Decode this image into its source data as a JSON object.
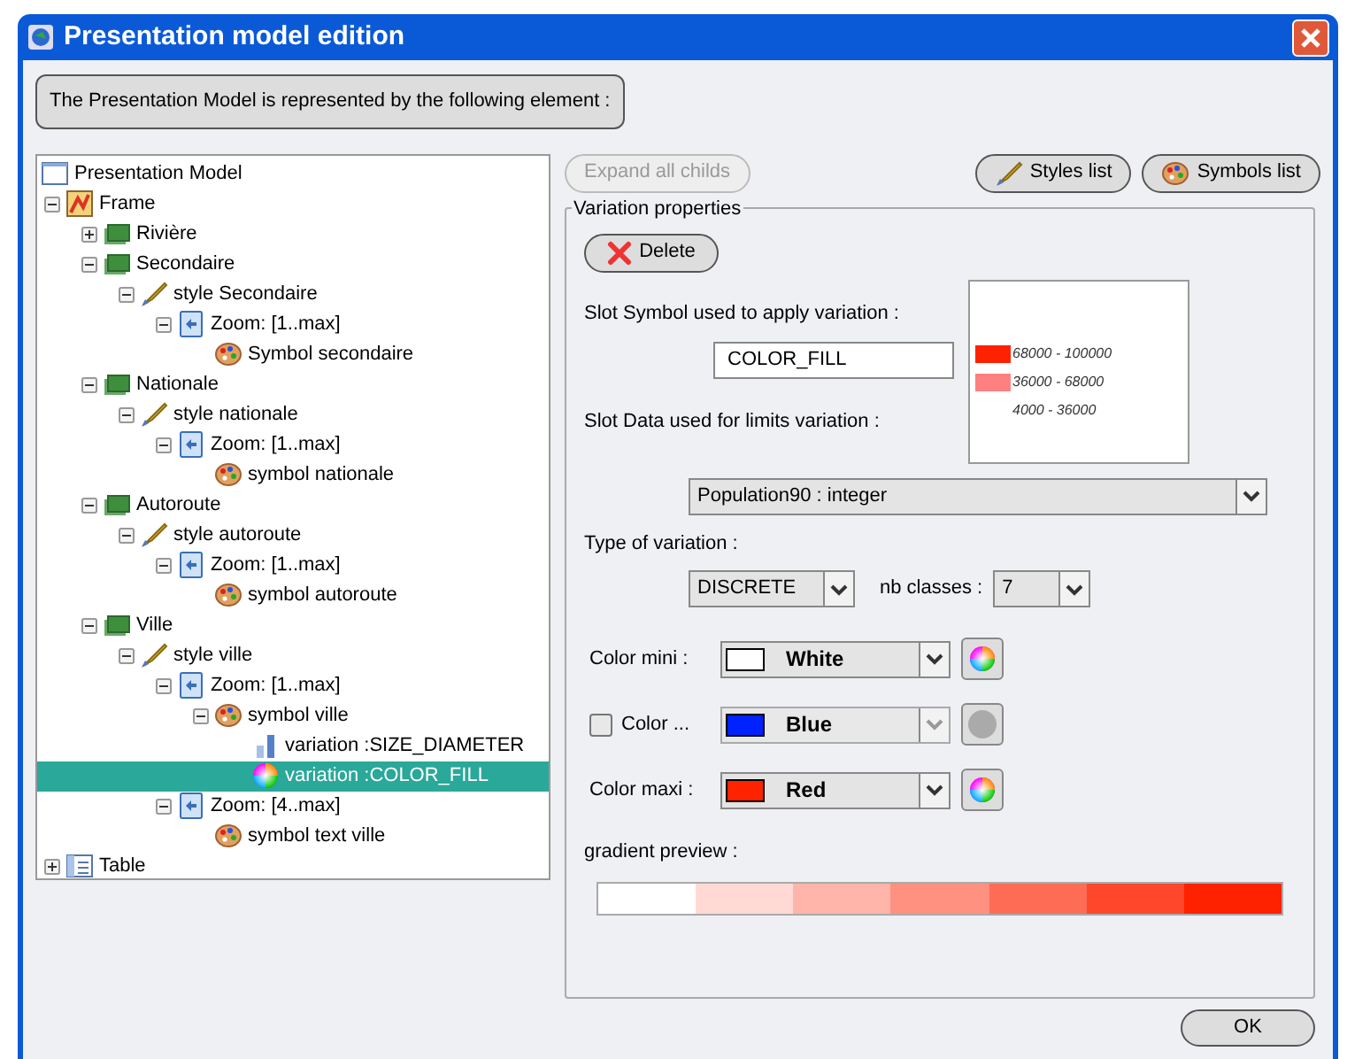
{
  "window": {
    "title": "Presentation model edition"
  },
  "header": "The Presentation Model is represented by the following element :",
  "tree": {
    "label": "Presentation Model",
    "kind": "root",
    "children": [
      {
        "label": "Frame",
        "kind": "frame",
        "expanded": true,
        "selected": false,
        "children": [
          {
            "label": "Rivière",
            "kind": "layer",
            "expanded": false,
            "selected": false
          },
          {
            "label": "Secondaire",
            "kind": "layer",
            "expanded": true,
            "selected": false,
            "children": [
              {
                "label": "style Secondaire",
                "kind": "style",
                "expanded": true,
                "selected": false,
                "children": [
                  {
                    "label": "Zoom: [1..max]",
                    "kind": "zoom",
                    "expanded": true,
                    "selected": false,
                    "children": [
                      {
                        "label": "Symbol secondaire",
                        "kind": "symbol",
                        "selected": false
                      }
                    ]
                  }
                ]
              }
            ]
          },
          {
            "label": "Nationale",
            "kind": "layer",
            "expanded": true,
            "selected": false,
            "children": [
              {
                "label": "style nationale",
                "kind": "style",
                "expanded": true,
                "selected": false,
                "children": [
                  {
                    "label": "Zoom: [1..max]",
                    "kind": "zoom",
                    "expanded": true,
                    "selected": false,
                    "children": [
                      {
                        "label": "symbol nationale",
                        "kind": "symbol",
                        "selected": false
                      }
                    ]
                  }
                ]
              }
            ]
          },
          {
            "label": "Autoroute",
            "kind": "layer",
            "expanded": true,
            "selected": false,
            "children": [
              {
                "label": "style autoroute",
                "kind": "style",
                "expanded": true,
                "selected": false,
                "children": [
                  {
                    "label": "Zoom: [1..max]",
                    "kind": "zoom",
                    "expanded": true,
                    "selected": false,
                    "children": [
                      {
                        "label": "symbol autoroute",
                        "kind": "symbol",
                        "selected": false
                      }
                    ]
                  }
                ]
              }
            ]
          },
          {
            "label": "Ville",
            "kind": "layer",
            "expanded": true,
            "selected": false,
            "children": [
              {
                "label": "style ville",
                "kind": "style",
                "expanded": true,
                "selected": false,
                "children": [
                  {
                    "label": "Zoom: [1..max]",
                    "kind": "zoom",
                    "expanded": true,
                    "selected": false,
                    "children": [
                      {
                        "label": "symbol ville",
                        "kind": "symbol",
                        "expanded": true,
                        "selected": false,
                        "children": [
                          {
                            "label": "variation :SIZE_DIAMETER",
                            "kind": "size_variation",
                            "selected": false
                          },
                          {
                            "label": "variation :COLOR_FILL",
                            "kind": "color_variation",
                            "selected": true
                          }
                        ]
                      }
                    ]
                  },
                  {
                    "label": "Zoom: [4..max]",
                    "kind": "zoom",
                    "expanded": true,
                    "selected": false,
                    "children": [
                      {
                        "label": "symbol text ville",
                        "kind": "symbol",
                        "selected": false
                      }
                    ]
                  }
                ]
              }
            ]
          }
        ]
      },
      {
        "label": "Table",
        "kind": "table",
        "expanded": false,
        "selected": false
      }
    ]
  },
  "toolbar": {
    "expand_button": {
      "label": "Expand all childs",
      "disabled": true
    },
    "styles_button": "Styles list",
    "symbols_button": "Symbols list"
  },
  "variation": {
    "group_title": "Variation properties",
    "delete_button": "Delete",
    "slot_symbol_label": "Slot Symbol used to apply variation :",
    "slot_symbol_value": "COLOR_FILL",
    "slot_data_label": "Slot Data used for limits variation :",
    "slot_data_value": "Population90 : integer",
    "legend": [
      {
        "label": "68000 - 100000",
        "color": "#ff2200"
      },
      {
        "label": "36000 - 68000",
        "color": "#ff8080"
      },
      {
        "label": "4000 - 36000"
      }
    ],
    "type_label": "Type of variation :",
    "type_value": "DISCRETE",
    "classes_label": "nb classes :",
    "classes_value": "7",
    "colors": [
      {
        "kind": "fixed",
        "label": "Color mini :",
        "value": "White",
        "color": "#ffffff",
        "disabled": false
      },
      {
        "kind": "optional",
        "label": "Color ...",
        "value": "Blue",
        "color": "#0022ff",
        "checked": false,
        "disabled": true
      },
      {
        "kind": "fixed",
        "label": "Color maxi :",
        "value": "Red",
        "color": "#ff2200",
        "disabled": false
      }
    ],
    "gradient_label": "gradient preview :"
  },
  "ok_button": "OK"
}
